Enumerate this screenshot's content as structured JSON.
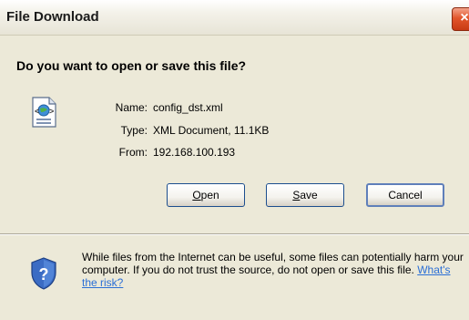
{
  "window": {
    "title": "File Download",
    "close_glyph": "×"
  },
  "dialog": {
    "question": "Do you want to open or save this file?",
    "file_icon": "xml-document-icon",
    "fields": [
      {
        "label": "Name:",
        "value": "config_dst.xml"
      },
      {
        "label": "Type:",
        "value": "XML Document, 11.1KB"
      },
      {
        "label": "From:",
        "value": "192.168.100.193"
      }
    ]
  },
  "buttons": {
    "open_underline": "O",
    "open_rest": "pen",
    "save_underline": "S",
    "save_rest": "ave",
    "cancel": "Cancel"
  },
  "warning": {
    "icon": "shield-question-icon",
    "text": "While files from the Internet can be useful, some files can potentially harm your computer. If you do not trust the source, do not open or save this file.",
    "link": "What's the risk?"
  },
  "colors": {
    "background": "#ece9d8",
    "close_button": "#e2562c",
    "link": "#2b6fd6",
    "shield": "#3b6cc4"
  }
}
